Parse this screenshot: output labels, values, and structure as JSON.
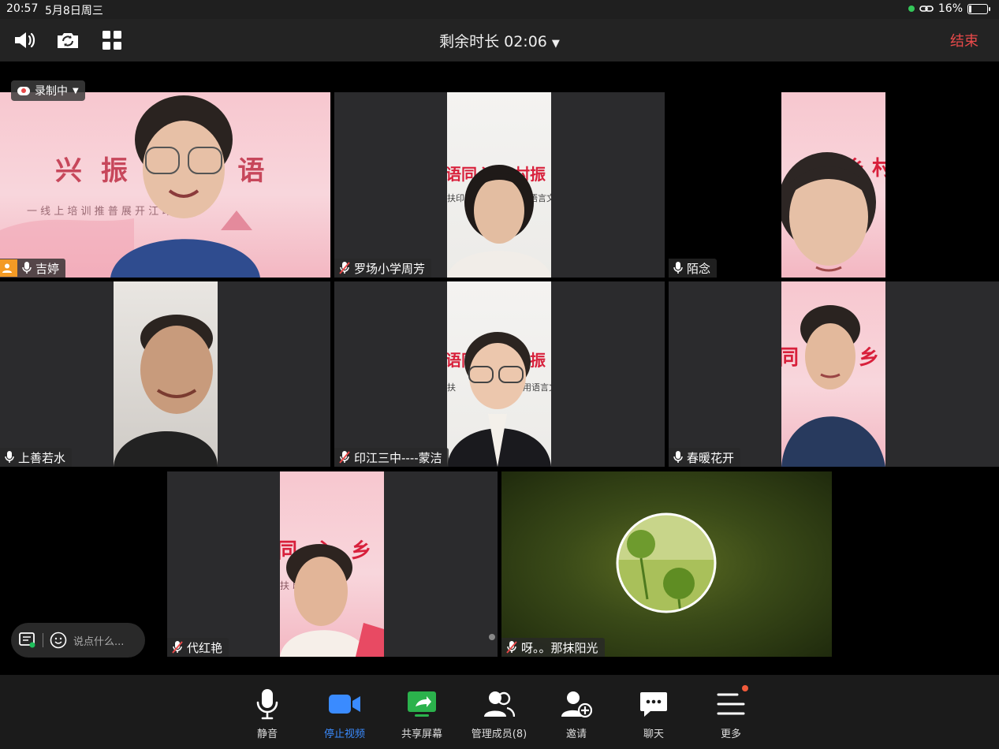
{
  "status_bar": {
    "time": "20:57",
    "date": "5月8日周三",
    "battery": "16%"
  },
  "top_bar": {
    "title": "剩余时长 02:06",
    "end_label": "结束",
    "end_color": "#e84a4a"
  },
  "recording": {
    "label": "录制中"
  },
  "participants": [
    {
      "name": "吉婷",
      "mic": "on",
      "host": true,
      "active_speaker": true
    },
    {
      "name": "罗场小学周芳",
      "mic": "muted"
    },
    {
      "name": "陌念",
      "mic": "on"
    },
    {
      "name": "上善若水",
      "mic": "on"
    },
    {
      "name": "印江三中----蒙洁",
      "mic": "muted"
    },
    {
      "name": "春暖花开",
      "mic": "on"
    },
    {
      "name": "代红艳",
      "mic": "muted"
    },
    {
      "name": "呀。。那抹阳光",
      "mic": "muted",
      "video": "off"
    }
  ],
  "banners": {
    "tile1_main": "兴 振 村 同 语",
    "tile1_sub": "一 线 上 培 训 推 普 展 开 江 印 扶",
    "tile2_main": "语同心 乡村振",
    "tile2_sub": "扶印",
    "tile2_sub_right": "语言文",
    "tile3_main": "乡 村",
    "tile5_main": "语同心 乡村振",
    "tile5_sub": "扶",
    "tile5_sub_right": "用语言文",
    "tile6_main": "同 心 乡 村",
    "tile7_main": "同 心 乡 村",
    "tile7_sub": "扶 印 江"
  },
  "chat": {
    "placeholder": "说点什么..."
  },
  "toolbar": {
    "mute": "静音",
    "stop_video": "停止视频",
    "share_screen": "共享屏幕",
    "manage_members": "管理成员(8)",
    "invite": "邀请",
    "chat": "聊天",
    "more": "更多"
  },
  "colors": {
    "active_border": "#1fbf5c",
    "video_blue": "#3a8bff",
    "share_green": "#2bb24c",
    "host_badge": "#f39a25"
  }
}
